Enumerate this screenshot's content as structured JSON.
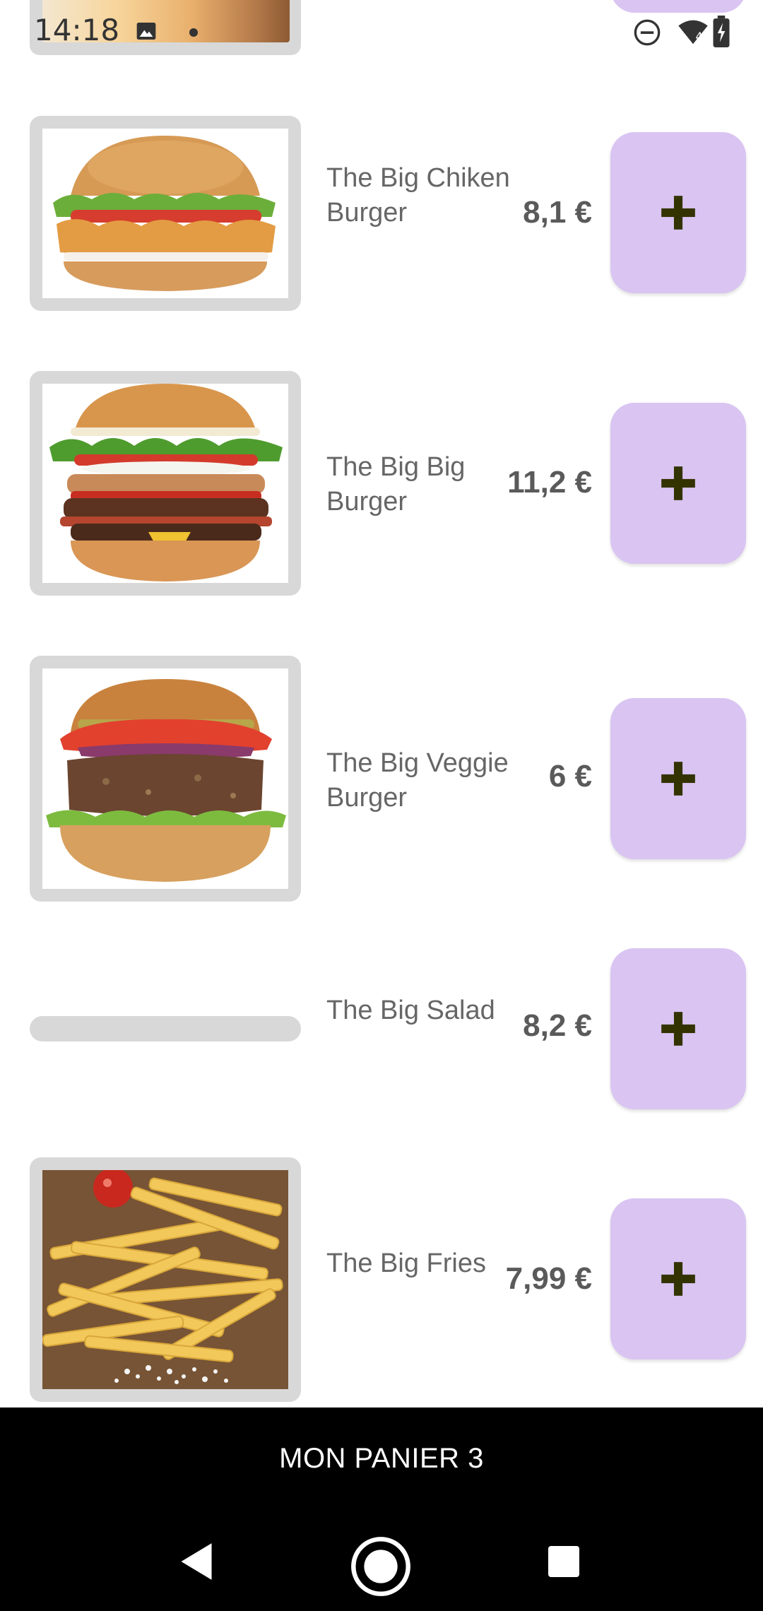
{
  "status_bar": {
    "time": "14:18",
    "icons": [
      "gallery-icon",
      "dot-icon",
      "do-not-disturb-icon",
      "wifi-icon",
      "battery-icon"
    ]
  },
  "products": [
    {
      "name": "The Big Chiken Burger",
      "price": "8,1 €",
      "image": "chicken-burger"
    },
    {
      "name": "The Big Big Burger",
      "price": "11,2 €",
      "image": "big-burger"
    },
    {
      "name": "The Big Veggie Burger",
      "price": "6 €",
      "image": "veggie-burger"
    },
    {
      "name": "The Big Salad",
      "price": "8,2 €",
      "image": "loading"
    },
    {
      "name": "The Big Fries",
      "price": "7,99 €",
      "image": "fries"
    }
  ],
  "add_button": {
    "icon": "plus-icon"
  },
  "cart": {
    "label": "MON PANIER 3"
  },
  "nav": {
    "icons": [
      "back-icon",
      "home-icon",
      "recents-icon"
    ]
  },
  "colors": {
    "add_button_bg": "#d9c4f2",
    "plus_icon": "#333300",
    "thumb_bg": "#d8d8d8",
    "cart_bar_bg": "#000000",
    "text_gray": "#666666"
  }
}
